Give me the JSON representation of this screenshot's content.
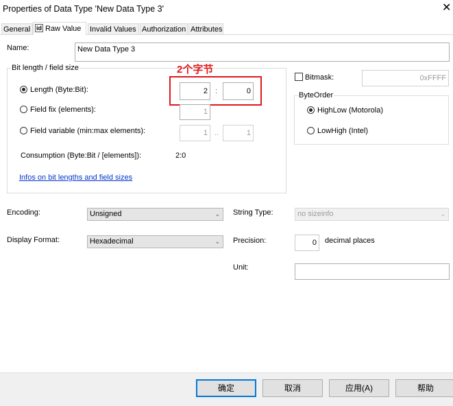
{
  "window": {
    "title": "Properties of Data Type 'New Data Type 3'"
  },
  "tabs": [
    {
      "label": "General"
    },
    {
      "badge": "id",
      "label": "Raw Value"
    },
    {
      "label": "Invalid Values"
    },
    {
      "label": "Authorization"
    },
    {
      "label": "Attributes"
    }
  ],
  "name": {
    "label": "Name:",
    "value": "New Data Type 3"
  },
  "bitlength": {
    "group_title": "Bit length / field size",
    "annotation": "2个字节",
    "length": {
      "label": "Length (Byte:Bit):",
      "byte": "2",
      "sep": ":",
      "bit": "0"
    },
    "field_fix": {
      "label": "Field fix (elements):",
      "value": "1"
    },
    "field_variable": {
      "label": "Field variable (min:max elements):",
      "min": "1",
      "sep": "..",
      "max": "1"
    },
    "consumption": {
      "label": "Consumption (Byte:Bit / [elements]):",
      "value": "2:0"
    },
    "link": "Infos on bit lengths and field sizes"
  },
  "bitmask": {
    "label": "Bitmask:",
    "value": "0xFFFF"
  },
  "byteorder": {
    "group_title": "ByteOrder",
    "highlow": "HighLow (Motorola)",
    "lowhigh": "LowHigh (Intel)"
  },
  "encoding": {
    "label": "Encoding:",
    "value": "Unsigned"
  },
  "display_format": {
    "label": "Display Format:",
    "value": "Hexadecimal"
  },
  "string_type": {
    "label": "String Type:",
    "value": "no sizeinfo"
  },
  "precision": {
    "label": "Precision:",
    "value": "0",
    "suffix": "decimal places"
  },
  "unit": {
    "label": "Unit:",
    "value": ""
  },
  "buttons": {
    "ok": "确定",
    "cancel": "取消",
    "apply": "应用(A)",
    "help": "帮助"
  }
}
